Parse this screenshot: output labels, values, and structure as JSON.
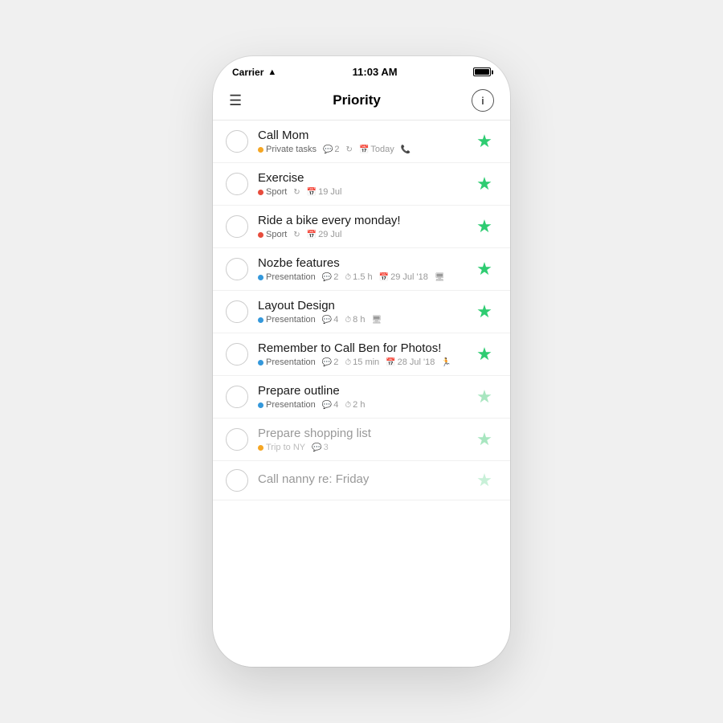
{
  "statusBar": {
    "carrier": "Carrier",
    "time": "11:03 AM"
  },
  "navBar": {
    "title": "Priority",
    "infoLabel": "i"
  },
  "tasks": [
    {
      "id": 1,
      "title": "Call Mom",
      "starColor": "green",
      "meta": [
        {
          "type": "tag",
          "dotColor": "#f5a623",
          "label": "Private tasks"
        },
        {
          "type": "comment",
          "icon": "💬",
          "value": "2"
        },
        {
          "type": "repeat",
          "icon": "↻",
          "value": ""
        },
        {
          "type": "date",
          "icon": "📅",
          "value": "Today"
        },
        {
          "type": "phone",
          "icon": "📞",
          "value": ""
        }
      ]
    },
    {
      "id": 2,
      "title": "Exercise",
      "starColor": "green",
      "meta": [
        {
          "type": "tag",
          "dotColor": "#e74c3c",
          "label": "Sport"
        },
        {
          "type": "repeat",
          "icon": "↻",
          "value": ""
        },
        {
          "type": "date",
          "icon": "📅",
          "value": "19 Jul"
        }
      ]
    },
    {
      "id": 3,
      "title": "Ride a bike every monday!",
      "starColor": "green",
      "meta": [
        {
          "type": "tag",
          "dotColor": "#e74c3c",
          "label": "Sport"
        },
        {
          "type": "repeat",
          "icon": "↻",
          "value": ""
        },
        {
          "type": "date",
          "icon": "📅",
          "value": "29 Jul"
        }
      ]
    },
    {
      "id": 4,
      "title": "Nozbe features",
      "starColor": "green",
      "meta": [
        {
          "type": "tag",
          "dotColor": "#3498db",
          "label": "Presentation"
        },
        {
          "type": "comment",
          "icon": "💬",
          "value": "2"
        },
        {
          "type": "time",
          "icon": "⏱",
          "value": "1.5 h"
        },
        {
          "type": "date",
          "icon": "📅",
          "value": "29 Jul '18"
        },
        {
          "type": "monitor",
          "icon": "🖥",
          "value": ""
        }
      ]
    },
    {
      "id": 5,
      "title": "Layout Design",
      "starColor": "green",
      "meta": [
        {
          "type": "tag",
          "dotColor": "#3498db",
          "label": "Presentation"
        },
        {
          "type": "comment",
          "icon": "💬",
          "value": "4"
        },
        {
          "type": "time",
          "icon": "⏱",
          "value": "8 h"
        },
        {
          "type": "monitor",
          "icon": "🖥",
          "value": ""
        }
      ]
    },
    {
      "id": 6,
      "title": "Remember to Call Ben for Photos!",
      "starColor": "green",
      "meta": [
        {
          "type": "tag",
          "dotColor": "#3498db",
          "label": "Presentation"
        },
        {
          "type": "comment",
          "icon": "💬",
          "value": "2"
        },
        {
          "type": "time",
          "icon": "⏱",
          "value": "15 min"
        },
        {
          "type": "date",
          "icon": "📅",
          "value": "28 Jul '18"
        },
        {
          "type": "run",
          "icon": "🏃",
          "value": ""
        }
      ]
    },
    {
      "id": 7,
      "title": "Prepare outline",
      "starColor": "light-green",
      "meta": [
        {
          "type": "tag",
          "dotColor": "#3498db",
          "label": "Presentation"
        },
        {
          "type": "comment",
          "icon": "💬",
          "value": "4"
        },
        {
          "type": "time",
          "icon": "⏱",
          "value": "2 h"
        }
      ]
    },
    {
      "id": 8,
      "title": "Prepare shopping list",
      "faded": true,
      "starColor": "light-green",
      "meta": [
        {
          "type": "tag",
          "dotColor": "#f5a623",
          "label": "Trip to NY",
          "faded": true
        },
        {
          "type": "comment",
          "icon": "💬",
          "value": "3",
          "faded": true
        }
      ]
    },
    {
      "id": 9,
      "title": "Call nanny re: Friday",
      "faded": true,
      "starColor": "very-light",
      "meta": []
    }
  ]
}
